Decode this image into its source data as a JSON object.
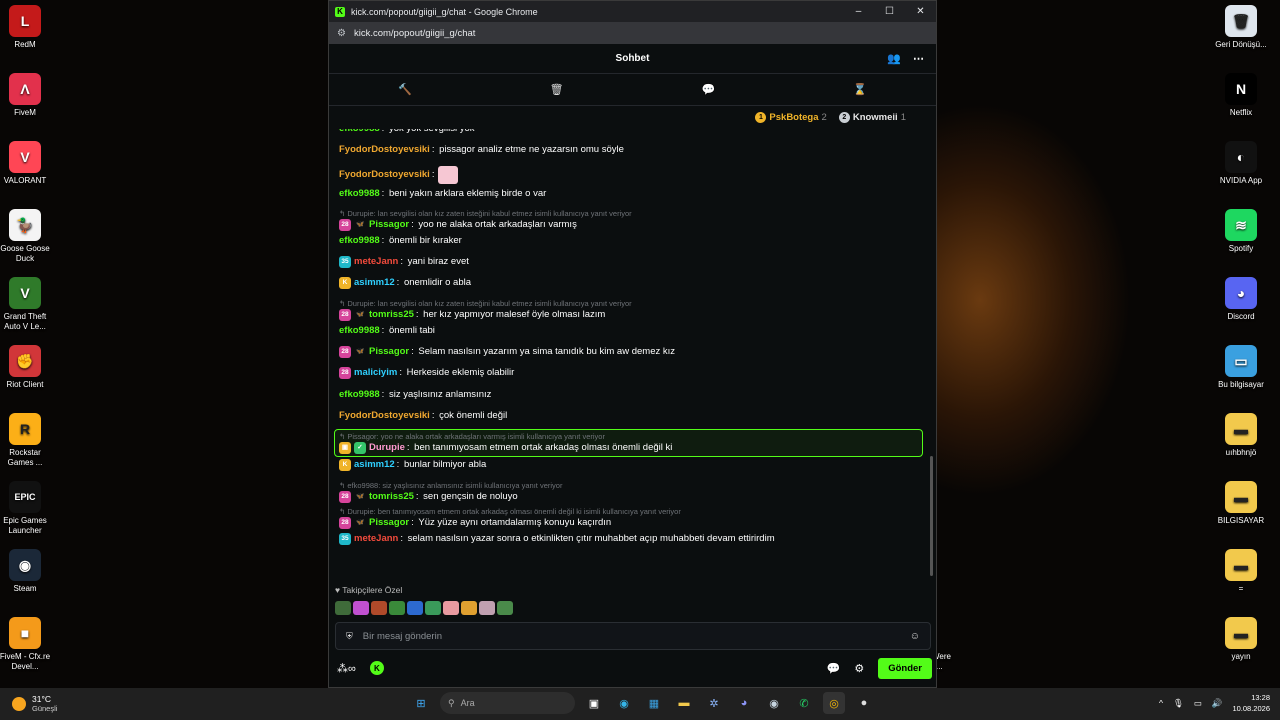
{
  "desktop": {
    "left_icons": [
      {
        "label": "RedM",
        "color": "#c41a1a",
        "glyph": "L"
      },
      {
        "label": "FiveM",
        "color": "#e2314c",
        "glyph": "Λ"
      },
      {
        "label": "VALORANT",
        "color": "#ff4655",
        "glyph": "V"
      },
      {
        "label": "Goose Goose Duck",
        "color": "#f4f4f4",
        "glyph": "🦆"
      },
      {
        "label": "Grand Theft Auto V Le...",
        "color": "#2f7a2a",
        "glyph": "V"
      },
      {
        "label": "Riot Client",
        "color": "#d13639",
        "glyph": "✊"
      },
      {
        "label": "Rockstar Games ...",
        "color": "#fcaf17",
        "glyph": "R"
      },
      {
        "label": "Epic Games Launcher",
        "color": "#111111",
        "glyph": "EPIC"
      },
      {
        "label": "Steam",
        "color": "#1b2838",
        "glyph": "◉"
      },
      {
        "label": "FiveM - Cfx.re Devel...",
        "color": "#f49a1a",
        "glyph": "■"
      }
    ],
    "right_icons": [
      {
        "label": "Geri Dönüşü...",
        "color": "#dfe6ee",
        "glyph": "🗑"
      },
      {
        "label": "Netflix",
        "color": "#000000",
        "glyph": "N"
      },
      {
        "label": "NVIDIA App",
        "color": "#111111",
        "glyph": "◐"
      },
      {
        "label": "Spotify",
        "color": "#1ed760",
        "glyph": "≋"
      },
      {
        "label": "Discord",
        "color": "#5865f2",
        "glyph": "◕"
      },
      {
        "label": "Bu bilgisayar",
        "color": "#3aa0e0",
        "glyph": "▭"
      },
      {
        "label": "uıhbhnjö",
        "color": "#f2c94c",
        "glyph": "▬"
      },
      {
        "label": "BILGISAYAR",
        "color": "#f2c94c",
        "glyph": "▬"
      },
      {
        "label": "=",
        "color": "#f2c94c",
        "glyph": "▬"
      },
      {
        "label": "yayın",
        "color": "#f2c94c",
        "glyph": "▬"
      }
    ],
    "partial_label": "Were T..."
  },
  "window": {
    "title": "kick.com/popout/giigii_g/chat - Google Chrome",
    "url": "kick.com/popout/giigii_g/chat",
    "min": "–",
    "max": "☐",
    "close": "✕"
  },
  "chat": {
    "header": "Sohbet",
    "gifters": [
      {
        "rank": "1",
        "name": "PskBotega",
        "count": "2",
        "rank_color": "#f0b429",
        "name_color": "#f0b429"
      },
      {
        "rank": "2",
        "name": "Knowmeii",
        "count": "1",
        "rank_color": "#c9ced3",
        "name_color": "#e6e6e6"
      }
    ],
    "messages": [
      {
        "reply": "",
        "badges": [],
        "user": "efko9988",
        "color": "#53fc18",
        "text": "yok yok sevgilisi yok"
      },
      {
        "reply": "",
        "badges": [],
        "user": "FyodorDostoyevsiki",
        "color": "#f0a830",
        "text": "pissagor analiz etme ne yazarsın omu söyle"
      },
      {
        "reply": "",
        "badges": [],
        "user": "FyodorDostoyevsiki",
        "color": "#f0a830",
        "text": "",
        "emote": true
      },
      {
        "reply": "",
        "badges": [],
        "user": "efko9988",
        "color": "#53fc18",
        "text": "beni yakın arklara eklemiş birde o var"
      },
      {
        "reply": "Durupie: lan sevgilisi olan kız zaten isteğini kabul etmez isimli kullanıcıya yanıt veriyor",
        "badges": [
          {
            "t": "28",
            "c": "#d6449b"
          },
          {
            "t": "🦋",
            "c": "transparent"
          }
        ],
        "user": "Pissagor",
        "color": "#53fc18",
        "text": "yoo ne alaka ortak arkadaşları varmış"
      },
      {
        "reply": "",
        "badges": [],
        "user": "efko9988",
        "color": "#53fc18",
        "text": "önemli bir kıraker"
      },
      {
        "reply": "",
        "badges": [
          {
            "t": "35",
            "c": "#1fb8c9"
          }
        ],
        "user": "meteJann",
        "color": "#f34b3c",
        "text": "yani biraz evet"
      },
      {
        "reply": "",
        "badges": [
          {
            "t": "K",
            "c": "#f0b429"
          }
        ],
        "user": "asimm12",
        "color": "#2fd0ff",
        "text": "onemlidir o abla"
      },
      {
        "reply": "Durupie: lan sevgilisi olan kız zaten isteğini kabul etmez isimli kullanıcıya yanıt veriyor",
        "badges": [
          {
            "t": "28",
            "c": "#d6449b"
          },
          {
            "t": "🦋",
            "c": "transparent"
          }
        ],
        "user": "tomriss25",
        "color": "#53fc18",
        "text": "her kız yapmıyor malesef öyle olması lazım"
      },
      {
        "reply": "",
        "badges": [],
        "user": "efko9988",
        "color": "#53fc18",
        "text": "önemli tabi"
      },
      {
        "reply": "",
        "badges": [
          {
            "t": "28",
            "c": "#d6449b"
          },
          {
            "t": "🦋",
            "c": "transparent"
          }
        ],
        "user": "Pissagor",
        "color": "#53fc18",
        "text": "Selam nasılsın yazarım ya sima tanıdık bu kim aw demez kız"
      },
      {
        "reply": "",
        "badges": [
          {
            "t": "28",
            "c": "#d6449b"
          }
        ],
        "user": "maliciyim",
        "color": "#2fd0ff",
        "text": "Herkeside eklemiş olabilir"
      },
      {
        "reply": "",
        "badges": [],
        "user": "efko9988",
        "color": "#53fc18",
        "text": "siz yaşlısınız anlamsınız"
      },
      {
        "reply": "",
        "badges": [],
        "user": "FyodorDostoyevsiki",
        "color": "#f0a830",
        "text": "çok önemli değil"
      },
      {
        "reply": "Pissagor: yoo ne alaka ortak arkadaşları varmış isimli kullanıcıya yanıt veriyor",
        "badges": [
          {
            "t": "▣",
            "c": "#f0b429"
          },
          {
            "t": "✓",
            "c": "#35c46a"
          }
        ],
        "user": "Durupie",
        "color": "#ff9ad0",
        "text": "ben tanımıyosam etmem ortak arkadaş olması önemli değil ki",
        "highlight": true
      },
      {
        "reply": "",
        "badges": [
          {
            "t": "K",
            "c": "#f0b429"
          }
        ],
        "user": "asimm12",
        "color": "#2fd0ff",
        "text": "bunlar bilmiyor abla"
      },
      {
        "reply": "efko9988: siz yaşlısınız anlamsınız isimli kullanıcıya yanıt veriyor",
        "badges": [
          {
            "t": "28",
            "c": "#d6449b"
          },
          {
            "t": "🦋",
            "c": "transparent"
          }
        ],
        "user": "tomriss25",
        "color": "#53fc18",
        "text": "sen gençsin de noluyo"
      },
      {
        "reply": "Durupie: ben tanımıyosam etmem ortak arkadaş olması önemli değil ki isimli kullanıcıya yanıt veriyor",
        "badges": [
          {
            "t": "28",
            "c": "#d6449b"
          },
          {
            "t": "🦋",
            "c": "transparent"
          }
        ],
        "user": "Pissagor",
        "color": "#53fc18",
        "text": "Yüz yüze aynı ortamdalarmış konuyu kaçırdın"
      },
      {
        "reply": "",
        "badges": [
          {
            "t": "35",
            "c": "#1fb8c9"
          }
        ],
        "user": "meteJann",
        "color": "#f34b3c",
        "text": "selam nasılsın yazar sonra o etkinlikten çıtır muhabbet açıp muhabbeti devam ettirirdim"
      }
    ],
    "follower_label": "Takipçilere Özel",
    "emote_colors": [
      "#3f6b3a",
      "#c050d0",
      "#b04a2a",
      "#3a8a3a",
      "#2d6ad0",
      "#3a9a5a",
      "#e89aa0",
      "#e0a030",
      "#c0a0b0",
      "#4a8a4a"
    ],
    "input_placeholder": "Bir mesaj gönderin",
    "send_label": "Gönder"
  },
  "taskbar": {
    "temp": "31°C",
    "weather": "Güneşli",
    "search": "Ara",
    "time": "13:28",
    "date": "10.08.2026"
  }
}
